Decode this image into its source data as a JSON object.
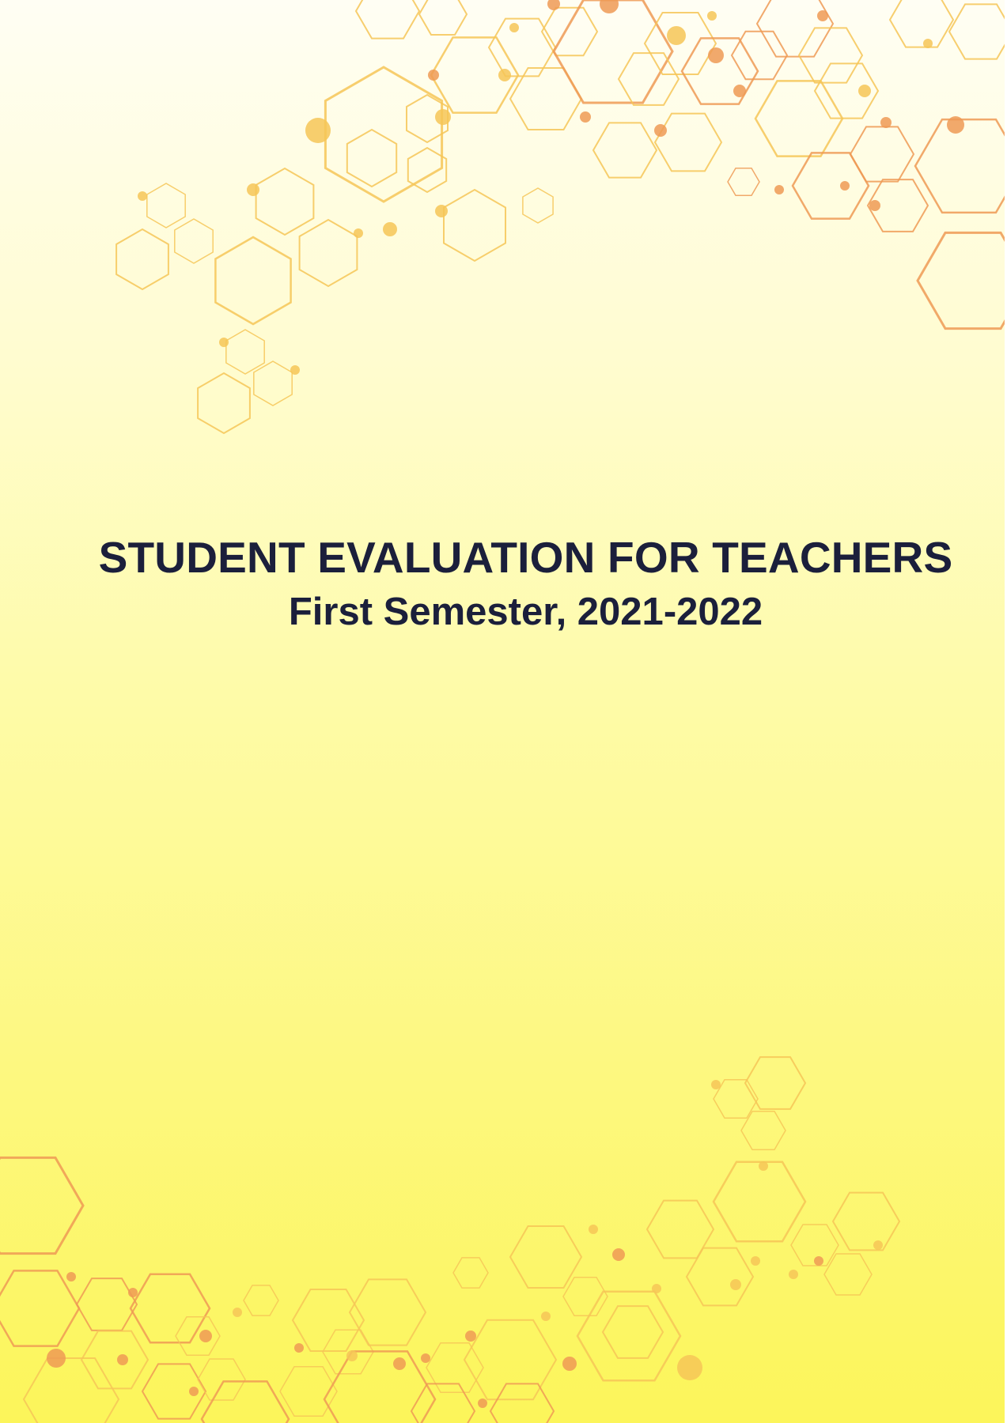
{
  "document": {
    "title": "STUDENT EVALUATION FOR TEACHERS",
    "subtitle": "First Semester, 2021-2022"
  },
  "colors": {
    "text": "#1b1f3b",
    "hex_yellow": "#f6c557",
    "hex_orange": "#ee9a55",
    "background_top": "#fffef4",
    "background_bottom": "#fcf55a"
  },
  "decoration": {
    "top_cluster": "hexagon-network",
    "bottom_cluster": "hexagon-network"
  }
}
